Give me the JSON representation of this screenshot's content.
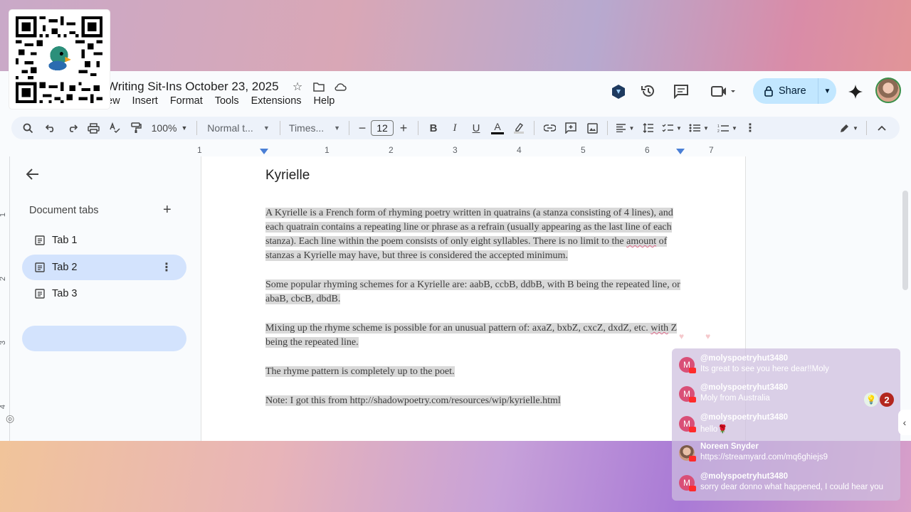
{
  "doc": {
    "title": "Writing Sit-Ins  October 23, 2025",
    "menu": [
      "ew",
      "Insert",
      "Format",
      "Tools",
      "Extensions",
      "Help"
    ],
    "share_label": "Share"
  },
  "toolbar": {
    "zoom": "100%",
    "style": "Normal t...",
    "font": "Times...",
    "font_size": "12"
  },
  "ruler": {
    "numbers": [
      "1",
      "1",
      "2",
      "3",
      "4",
      "5",
      "6",
      "7"
    ]
  },
  "vruler": {
    "numbers": [
      "1",
      "2",
      "3",
      "4"
    ]
  },
  "sidebar": {
    "heading": "Document tabs",
    "tabs": [
      {
        "label": "Tab 1",
        "active": false
      },
      {
        "label": "Tab 2",
        "active": true
      },
      {
        "label": "Tab 3",
        "active": false
      }
    ]
  },
  "document": {
    "heading": "Kyrielle",
    "p1_a": "A Kyrielle is a French form of rhyming poetry written in quatrains (a stanza consisting of 4 lines), and each quatrain contains a repeating line or phrase as a refrain (usually appearing as the last line of each stanza). Each line within the poem consists of only eight syllables. There is no limit to the ",
    "p1_sq": "amount",
    "p1_b": " of stanzas a Kyrielle may have, but three is considered the accepted minimum.",
    "p2": "Some popular rhyming schemes for a Kyrielle are: aabB, ccbB, ddbB, with B being the repeated line, or abaB, cbcB, dbdB.",
    "p3_a": "Mixing up the rhyme scheme is possible for an unusual pattern of: axaZ, bxbZ, cxcZ, dxdZ, etc. ",
    "p3_sq": "with",
    "p3_b": " Z being the repeated line.",
    "p4": "The rhyme pattern is completely up to the poet.",
    "p5": "Note: I got this from  http://shadowpoetry.com/resources/wip/kyrielle.html"
  },
  "chat": {
    "messages": [
      {
        "name": "@molyspoetryhut3480",
        "text": "Its great to see you here dear!!Moly",
        "avatar": "M"
      },
      {
        "name": "@molyspoetryhut3480",
        "text": "Moly from Australia",
        "avatar": "M"
      },
      {
        "name": "@molyspoetryhut3480",
        "text": "hello🌹",
        "avatar": "M"
      },
      {
        "name": "Noreen Snyder",
        "text": "https://streamyard.com/mq6ghiejs9",
        "avatar": ""
      },
      {
        "name": "@molyspoetryhut3480",
        "text": "sorry dear donno what happened, I could hear you",
        "avatar": "M"
      }
    ],
    "notification_count": "2"
  },
  "colors": {
    "share_bg": "#c2e7ff",
    "active_tab": "#d3e3fd",
    "toolbar_bg": "#edf2fa",
    "highlight": "#d9d9d9"
  }
}
